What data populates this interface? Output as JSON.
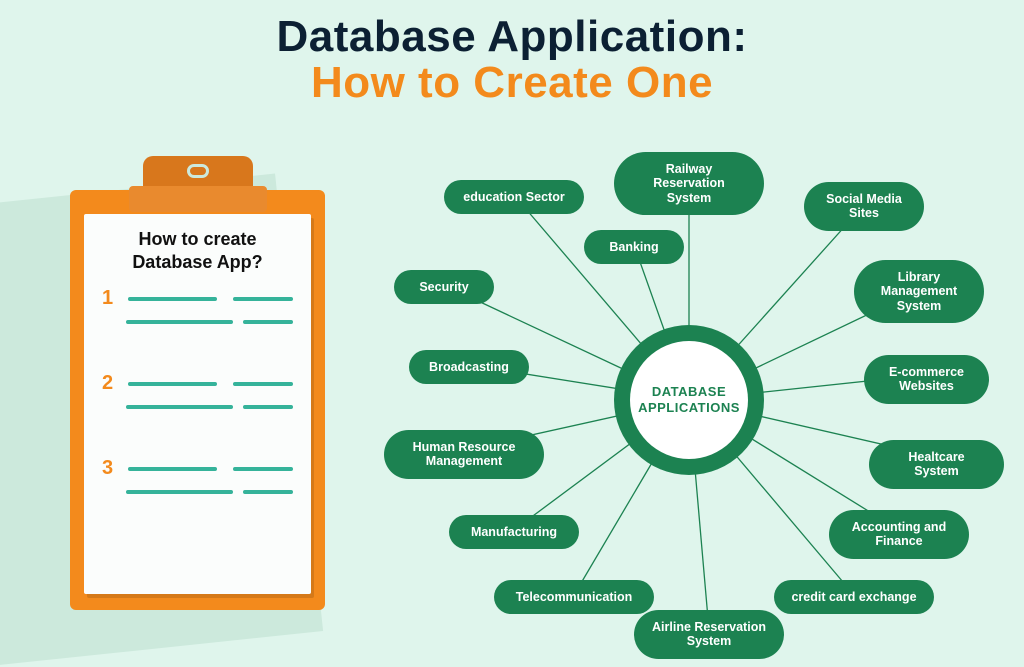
{
  "title": {
    "line1": "Database Application:",
    "line2": "How to Create One"
  },
  "clipboard": {
    "heading": "How to create\nDatabase App?",
    "steps": [
      "1",
      "2",
      "3"
    ]
  },
  "mindmap": {
    "center_line1": "DATABASE",
    "center_line2": "APPLICATIONS",
    "nodes": [
      "education Sector",
      "Railway Reservation System",
      "Social Media Sites",
      "Banking",
      "Security",
      "Library Management System",
      "Broadcasting",
      "E-commerce Websites",
      "Human Resource Management",
      "Healtcare System",
      "Manufacturing",
      "Accounting and Finance",
      "Telecommunication",
      "credit card exchange",
      "Airline Reservation System"
    ]
  }
}
